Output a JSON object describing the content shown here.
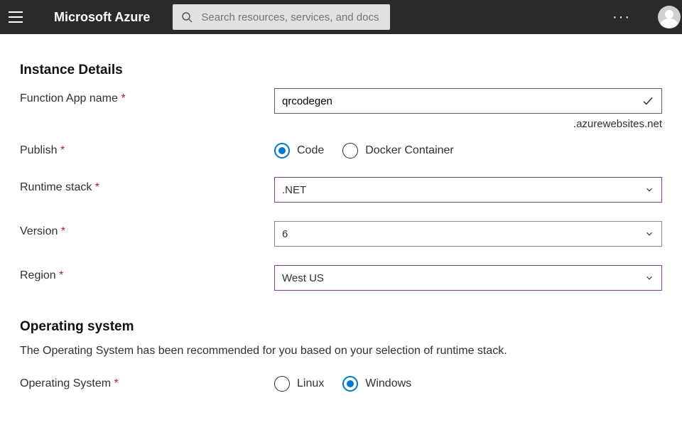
{
  "header": {
    "brand": "Microsoft Azure",
    "search_placeholder": "Search resources, services, and docs (G+/)"
  },
  "sections": {
    "instance": {
      "title": "Instance Details",
      "fields": {
        "appname": {
          "label": "Function App name",
          "value": "qrcodegen",
          "suffix": ".azurewebsites.net"
        },
        "publish": {
          "label": "Publish",
          "options": {
            "code": "Code",
            "docker": "Docker Container"
          },
          "selected": "code"
        },
        "runtime": {
          "label": "Runtime stack",
          "value": ".NET"
        },
        "version": {
          "label": "Version",
          "value": "6"
        },
        "region": {
          "label": "Region",
          "value": "West US"
        }
      }
    },
    "os": {
      "title": "Operating system",
      "help": "The Operating System has been recommended for you based on your selection of runtime stack.",
      "fields": {
        "os": {
          "label": "Operating System",
          "options": {
            "linux": "Linux",
            "windows": "Windows"
          },
          "selected": "windows"
        }
      }
    }
  },
  "required_mark": "*"
}
